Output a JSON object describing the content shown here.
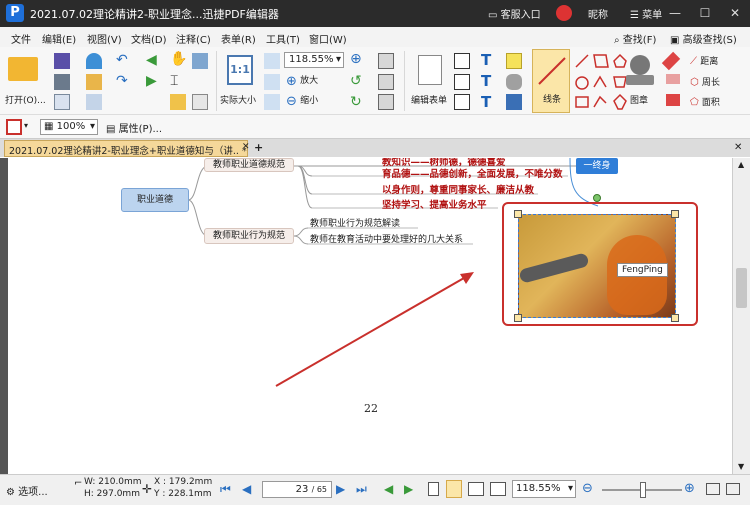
{
  "title": {
    "app_title": "2021.07.02理论精讲2-职业理念...迅捷PDF编辑器",
    "support": "客服入口",
    "nickname": "昵称",
    "menu": "菜单"
  },
  "menu": [
    "文件",
    "编辑(E)",
    "视图(V)",
    "文档(D)",
    "注释(C)",
    "表单(R)",
    "工具(T)",
    "窗口(W)"
  ],
  "search": {
    "find": "查找(F)",
    "advanced": "高级查找(S)"
  },
  "ribbon": {
    "open": "打开(O)...",
    "actual_size": "实际大小",
    "zoom_value": "118.55%",
    "zoom_in": "放大",
    "zoom_out": "缩小",
    "edit_form": "编辑表单",
    "line": "线条",
    "stamp": "图章",
    "distance": "距离",
    "perimeter": "周长",
    "area": "面积"
  },
  "props": {
    "opacity": "100%",
    "properties": "属性(P)..."
  },
  "tab": {
    "label": "2021.07.02理论精讲2-职业理念+职业道德知与（讲..  *"
  },
  "doc": {
    "node_main": "职业道德",
    "node_norms": "教师职业道德规范",
    "node_behavior": "教师职业行为规范",
    "line1": "教知识——树师德，德德喜爱",
    "line2": "育品德——品德创新，全面发展，不唯分数",
    "line3": "以身作则，尊重同事家长、廉洁从教",
    "line4": "坚持学习、提高业务水平",
    "behavior1": "教师职业行为规范解读",
    "behavior2": "教师在教育活动中要处理好的几大关系",
    "top_right_box": "一终身",
    "image_caption": "FengPing",
    "page_number": "22"
  },
  "colors": {
    "accent_red": "#c9302c",
    "titlebar": "#2b2b2b",
    "tab": "#f5d89a",
    "node_blue": "#bcd4ef"
  },
  "status": {
    "options": "选项...",
    "width": "W: 210.0mm",
    "height": "H: 297.0mm",
    "x": "X : 179.2mm",
    "y": "Y : 228.1mm",
    "page_current": "23",
    "page_total": "/ 65",
    "zoom": "118.55%"
  }
}
